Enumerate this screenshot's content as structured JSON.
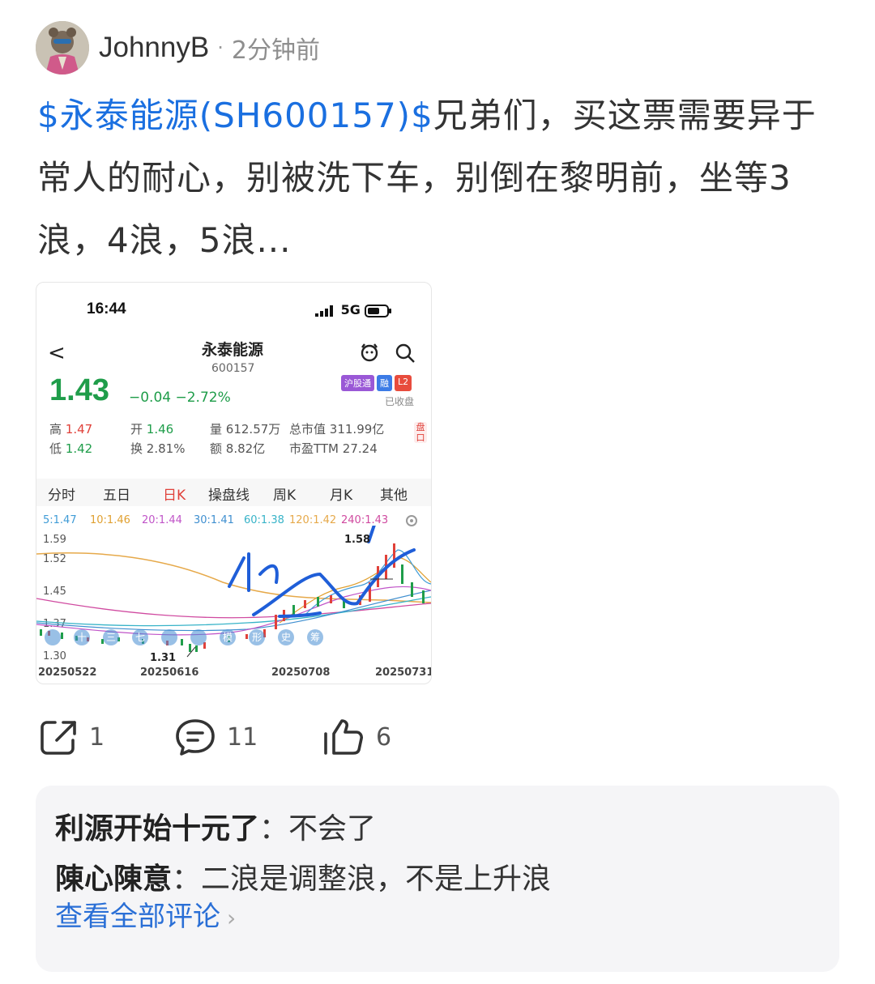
{
  "post": {
    "author": "JohnnyB",
    "separator": "·",
    "time_ago": "2分钟前",
    "stock_tag": "$永泰能源(SH600157)$",
    "text": "兄弟们，买这票需要异于常人的耐心，别被洗下车，别倒在黎明前，坐等3浪，4浪，5浪..."
  },
  "screenshot": {
    "clock": "16:44",
    "network": "5G",
    "back": "<",
    "stock_name": "永泰能源",
    "stock_code": "600157",
    "price": "1.43",
    "change": "−0.04  −2.72%",
    "badges": [
      {
        "label": "沪股通",
        "color": "#9a58d6"
      },
      {
        "label": "融",
        "color": "#3c7be6"
      },
      {
        "label": "L2",
        "color": "#e84c3d"
      }
    ],
    "closed": "已收盘",
    "stats": {
      "high_label": "高",
      "high": "1.47",
      "low_label": "低",
      "low": "1.42",
      "open_label": "开",
      "open": "1.46",
      "turnover_label": "换",
      "turnover": "2.81%",
      "volume_label": "量",
      "volume": "612.57万",
      "amount_label": "额",
      "amount": "8.82亿",
      "mcap_label": "总市值",
      "mcap": "311.99亿",
      "pe_label": "市盈TTM",
      "pe": "27.24",
      "side": "盘口"
    },
    "tabs": [
      "分时",
      "五日",
      "日K",
      "操盘线",
      "周K",
      "月K",
      "其他"
    ],
    "ma": [
      {
        "label": "5:1.47",
        "color": "#3f9bd6"
      },
      {
        "label": "10:1.46",
        "color": "#e0a030"
      },
      {
        "label": "20:1.44",
        "color": "#c054c8"
      },
      {
        "label": "30:1.41",
        "color": "#3f8fd0"
      },
      {
        "label": "60:1.38",
        "color": "#37b3c8"
      },
      {
        "label": "120:1.42",
        "color": "#e6a94a"
      },
      {
        "label": "240:1.43",
        "color": "#d04aa0"
      }
    ],
    "y_ticks": [
      "1.59",
      "1.52",
      "1.45",
      "1.37",
      "1.30"
    ],
    "x_ticks": [
      "20250522",
      "20250616",
      "20250708",
      "20250731"
    ],
    "high_mark": "1.58",
    "low_mark": "1.31",
    "handwriting": "1浪2浪",
    "toolbar_chars": [
      "十",
      "三",
      "七",
      "模",
      "形",
      "史",
      "筹"
    ]
  },
  "actions": {
    "share_count": "1",
    "comment_count": "11",
    "like_count": "6"
  },
  "comments": [
    {
      "user": "利源开始十元了",
      "text": "：不会了"
    },
    {
      "user": "陳心陳意",
      "text": "：二浪是调整浪，不是上升浪"
    }
  ],
  "view_all": "查看全部评论",
  "colors": {
    "link": "#1a6fe0",
    "down_green": "#1f9d4a",
    "up_red": "#e0413a",
    "ink_blue": "#1f5ed8"
  }
}
